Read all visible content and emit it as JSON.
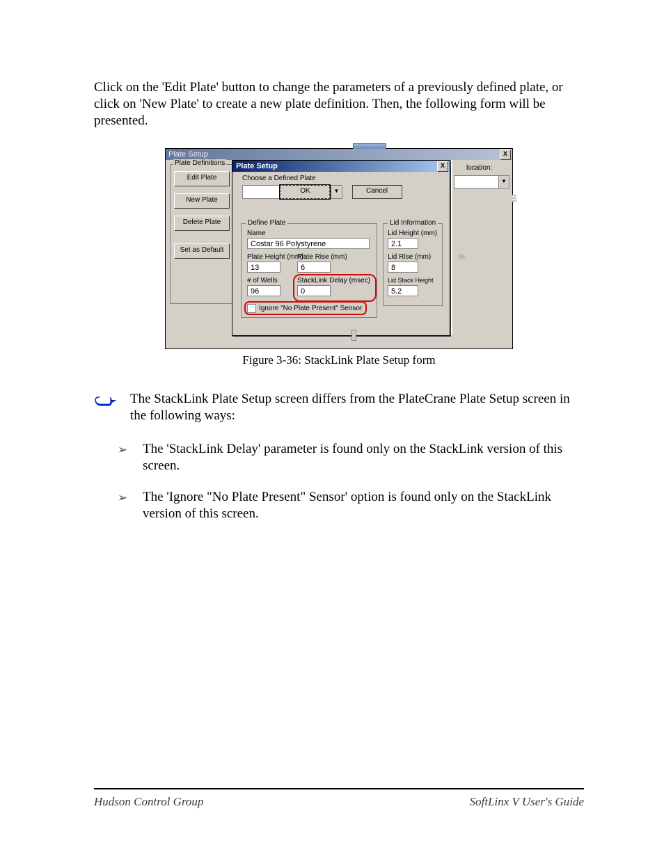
{
  "intro": "Click on the 'Edit Plate' button to change the parameters of a previously defined plate, or click on 'New Plate' to create a new plate definition.  Then, the following form will be presented.",
  "outer_window": {
    "title": "Plate Setup",
    "close": "X",
    "sidebar": {
      "legend": "Plate Definitions",
      "buttons": [
        "Edit Plate",
        "New Plate",
        "Delete Plate",
        "Set as Default"
      ]
    },
    "right": {
      "label": "location:",
      "small": "95"
    }
  },
  "inner_dialog": {
    "title": "Plate Setup",
    "close": "X",
    "choose_label": "Choose a Defined Plate",
    "define": {
      "legend": "Define Plate",
      "name_label": "Name",
      "name_value": "Costar 96 Polystyrene",
      "plate_height_label": "Plate Height (mm)",
      "plate_height_value": "13",
      "plate_rise_label": "Plate Rise (mm)",
      "plate_rise_value": "6",
      "wells_label": "# of Wells",
      "wells_value": "96",
      "delay_label": "StackLink Delay (msec)",
      "delay_value": "0",
      "ignore_label": "Ignore \"No Plate Present\" Sensor"
    },
    "lid": {
      "legend": "Lid Information",
      "height_label": "Lid Height (mm)",
      "height_value": "2.1",
      "rise_label": "Lid Rise (mm)",
      "rise_value": "8",
      "stack_label": "Lid Stack Height (mm)",
      "stack_value": "5.2"
    },
    "ok": "OK",
    "cancel": "Cancel"
  },
  "caption": "Figure 3-36:  StackLink Plate Setup form",
  "note": "The StackLink Plate Setup screen differs from the PlateCrane Plate Setup screen in the following ways:",
  "bullets": [
    "The 'StackLink Delay' parameter is found only on the StackLink version of this screen.",
    "The 'Ignore \"No Plate Present\" Sensor' option is found only on the StackLink version of this screen."
  ],
  "footer": {
    "left": "Hudson Control Group",
    "right": "SoftLinx V User's Guide"
  }
}
